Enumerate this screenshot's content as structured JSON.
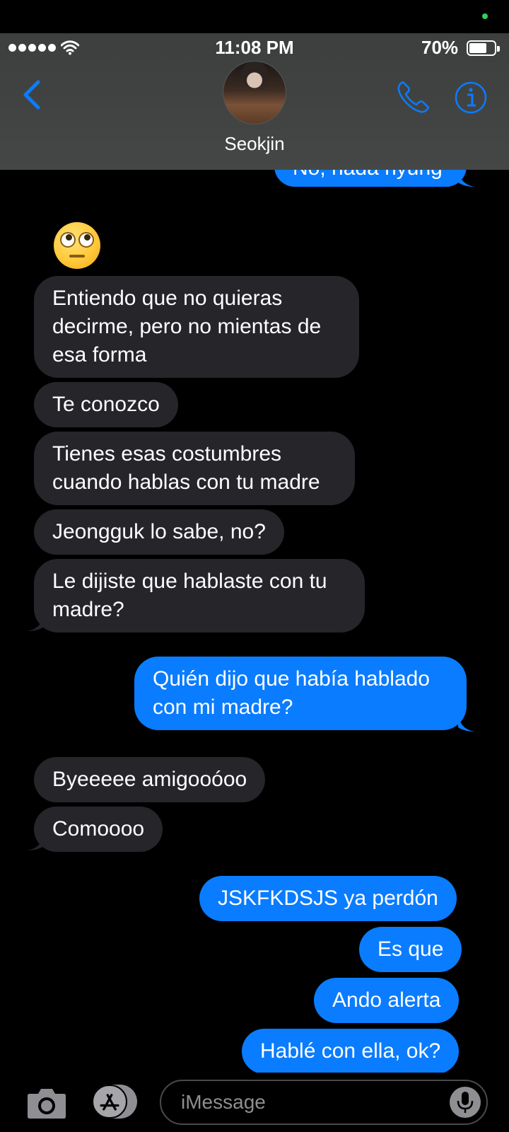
{
  "status_bar": {
    "time": "11:08 PM",
    "battery": "70%",
    "battery_level": 0.7
  },
  "header": {
    "contact_name": "Seokjin",
    "back_icon": "chevron-left-icon",
    "call_icon": "phone-icon",
    "info_icon": "info-icon"
  },
  "messages": [
    {
      "side": "out",
      "text": "No, nada hyung"
    },
    {
      "side": "in",
      "text": "🙄"
    },
    {
      "side": "in",
      "text": "Entiendo que no quieras decirme, pero no mientas de esa forma"
    },
    {
      "side": "in",
      "text": "Te conozco"
    },
    {
      "side": "in",
      "text": "Tienes esas costumbres cuando hablas con tu madre"
    },
    {
      "side": "in",
      "text": "Jeongguk lo sabe, no?"
    },
    {
      "side": "in",
      "text": "Le dijiste que hablaste con tu madre?"
    },
    {
      "side": "out",
      "text": "Quién dijo que había hablado con mi madre?"
    },
    {
      "side": "in",
      "text": "Byeeeee amigooóoo"
    },
    {
      "side": "in",
      "text": "Comoooo"
    },
    {
      "side": "out",
      "text": "JSKFKDSJS ya perdón"
    },
    {
      "side": "out",
      "text": "Es que"
    },
    {
      "side": "out",
      "text": "Ando alerta"
    },
    {
      "side": "out",
      "text": "Hablé con ella, ok?"
    }
  ],
  "input": {
    "placeholder": "iMessage",
    "camera_icon": "camera-icon",
    "apps_icon": "app-store-icon",
    "mic_icon": "microphone-icon"
  },
  "colors": {
    "incoming_bubble": "#26252a",
    "outgoing_bubble": "#0a7cff",
    "accent": "#0a7cff",
    "header_bg": "#424444"
  }
}
